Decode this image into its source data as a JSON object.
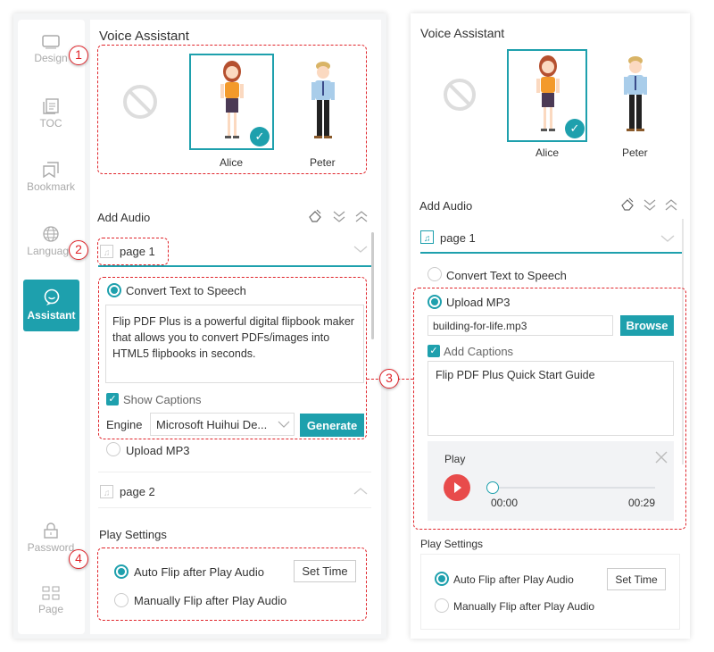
{
  "colors": {
    "accent": "#1ea0ad",
    "annotation": "#e0252b",
    "play": "#e84b4b"
  },
  "sidebar": {
    "items": [
      {
        "label": "Design",
        "icon": "monitor-icon"
      },
      {
        "label": "TOC",
        "icon": "toc-icon"
      },
      {
        "label": "Bookmark",
        "icon": "bookmark-icon"
      },
      {
        "label": "Language",
        "icon": "globe-icon"
      },
      {
        "label": "Assistant",
        "icon": "chat-icon",
        "active": true
      },
      {
        "label": "Password",
        "icon": "lock-icon"
      },
      {
        "label": "Page",
        "icon": "grid-icon"
      }
    ]
  },
  "annotations": [
    "1",
    "2",
    "3",
    "4"
  ],
  "left": {
    "title": "Voice Assistant",
    "voices": [
      {
        "name": "Alice",
        "selected": true
      },
      {
        "name": "Peter",
        "selected": false
      }
    ],
    "add_audio": "Add Audio",
    "page1": "page 1",
    "tts_label": "Convert Text to Speech",
    "tts_text": "Flip PDF Plus is a powerful digital flipbook maker that allows you to convert PDFs/images into HTML5 flipbooks in seconds.",
    "show_captions": "Show Captions",
    "engine_label": "Engine",
    "engine_value": "Microsoft Huihui De...",
    "generate": "Generate",
    "upload_mp3": "Upload MP3",
    "page2": "page 2",
    "play_settings": "Play Settings",
    "auto_flip": "Auto Flip after Play Audio",
    "set_time": "Set Time",
    "manual_flip": "Manually Flip after Play Audio"
  },
  "right": {
    "title": "Voice Assistant",
    "voices": [
      {
        "name": "Alice",
        "selected": true
      },
      {
        "name": "Peter",
        "selected": false
      }
    ],
    "add_audio": "Add Audio",
    "page1": "page 1",
    "tts_label": "Convert Text to Speech",
    "upload_mp3": "Upload MP3",
    "file_value": "building-for-life.mp3",
    "browse": "Browse",
    "add_captions": "Add Captions",
    "caption_text": "Flip PDF Plus Quick Start Guide",
    "player": {
      "label": "Play",
      "current": "00:00",
      "duration": "00:29",
      "progress": 0
    },
    "play_settings": "Play Settings",
    "auto_flip": "Auto Flip after Play Audio",
    "set_time": "Set Time",
    "manual_flip": "Manually Flip after Play Audio"
  }
}
